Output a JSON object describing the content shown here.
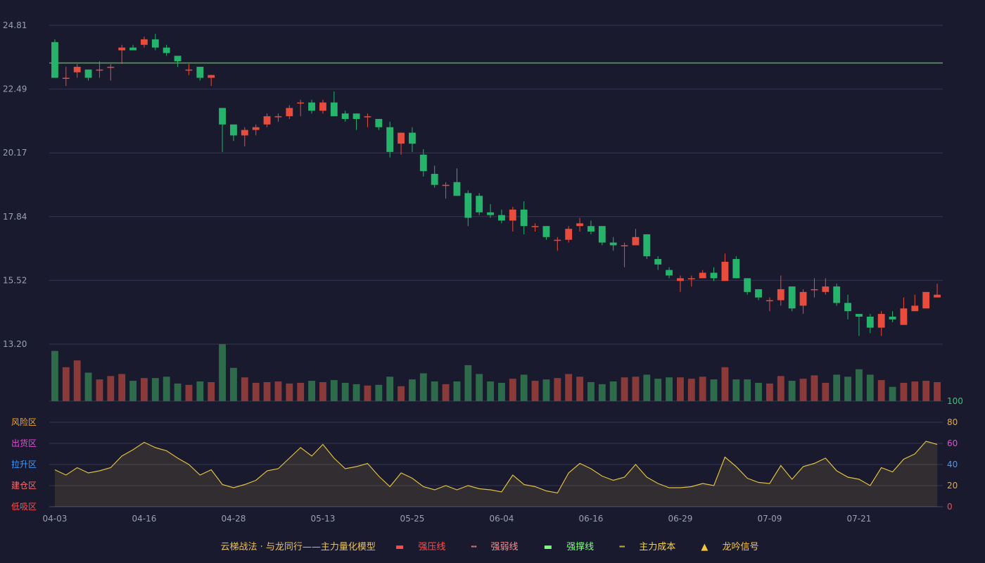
{
  "chart_data": {
    "type": "candlestick",
    "price_axis": {
      "ticks": [
        "24.81",
        "22.49",
        "20.17",
        "17.84",
        "15.52",
        "13.20"
      ],
      "ylim": [
        13.2,
        24.81
      ]
    },
    "reference_line": {
      "value": 23.44,
      "color": "#4caf50"
    },
    "x_labels": [
      "04-03",
      "04-16",
      "04-28",
      "05-13",
      "05-25",
      "06-04",
      "06-16",
      "06-29",
      "07-09",
      "07-21"
    ],
    "x_label_index": [
      0,
      8,
      16,
      24,
      32,
      40,
      48,
      56,
      64,
      72
    ],
    "candles": [
      [
        24.2,
        22.9,
        24.3,
        22.9
      ],
      [
        22.9,
        22.9,
        23.3,
        22.6
      ],
      [
        23.1,
        23.3,
        23.4,
        22.9
      ],
      [
        23.2,
        22.9,
        23.2,
        22.8
      ],
      [
        23.2,
        23.2,
        23.5,
        22.9
      ],
      [
        23.3,
        23.3,
        23.4,
        22.8
      ],
      [
        23.9,
        24.0,
        24.1,
        23.4
      ],
      [
        24.0,
        23.9,
        24.1,
        23.9
      ],
      [
        24.1,
        24.3,
        24.4,
        24.0
      ],
      [
        24.3,
        24.0,
        24.5,
        23.9
      ],
      [
        24.0,
        23.8,
        24.1,
        23.7
      ],
      [
        23.7,
        23.5,
        23.7,
        23.3
      ],
      [
        23.2,
        23.2,
        23.4,
        23.0
      ],
      [
        23.3,
        22.9,
        23.3,
        22.8
      ],
      [
        22.9,
        23.0,
        23.0,
        22.6
      ],
      [
        21.8,
        21.2,
        21.8,
        20.2
      ],
      [
        21.2,
        20.8,
        21.2,
        20.6
      ],
      [
        20.8,
        21.0,
        21.1,
        20.4
      ],
      [
        21.0,
        21.1,
        21.2,
        20.8
      ],
      [
        21.2,
        21.5,
        21.6,
        21.1
      ],
      [
        21.5,
        21.5,
        21.6,
        21.3
      ],
      [
        21.5,
        21.8,
        21.9,
        21.4
      ],
      [
        22.0,
        22.0,
        22.1,
        21.5
      ],
      [
        22.0,
        21.7,
        22.1,
        21.6
      ],
      [
        21.7,
        22.0,
        22.1,
        21.6
      ],
      [
        22.0,
        21.5,
        22.4,
        21.5
      ],
      [
        21.6,
        21.4,
        21.7,
        21.3
      ],
      [
        21.6,
        21.4,
        21.6,
        21.0
      ],
      [
        21.5,
        21.5,
        21.6,
        21.1
      ],
      [
        21.4,
        21.1,
        21.4,
        21.0
      ],
      [
        21.1,
        20.2,
        21.3,
        20.0
      ],
      [
        20.5,
        20.9,
        20.9,
        20.1
      ],
      [
        20.9,
        20.5,
        21.1,
        20.2
      ],
      [
        20.1,
        19.5,
        20.3,
        19.3
      ],
      [
        19.4,
        19.0,
        19.7,
        18.9
      ],
      [
        19.0,
        19.0,
        19.1,
        18.5
      ],
      [
        19.1,
        18.6,
        19.6,
        18.6
      ],
      [
        18.7,
        17.8,
        18.8,
        17.5
      ],
      [
        18.6,
        18.0,
        18.7,
        17.9
      ],
      [
        18.0,
        17.9,
        18.3,
        17.8
      ],
      [
        17.9,
        17.7,
        18.1,
        17.6
      ],
      [
        17.7,
        18.1,
        18.2,
        17.3
      ],
      [
        18.1,
        17.5,
        18.4,
        17.2
      ],
      [
        17.5,
        17.5,
        17.6,
        17.3
      ],
      [
        17.5,
        17.1,
        17.5,
        17.0
      ],
      [
        17.0,
        17.0,
        17.1,
        16.6
      ],
      [
        17.0,
        17.4,
        17.5,
        16.9
      ],
      [
        17.5,
        17.6,
        17.8,
        17.3
      ],
      [
        17.5,
        17.3,
        17.7,
        17.2
      ],
      [
        17.5,
        16.9,
        17.5,
        16.8
      ],
      [
        16.9,
        16.8,
        17.1,
        16.6
      ],
      [
        16.8,
        16.8,
        16.9,
        16.0
      ],
      [
        16.8,
        17.1,
        17.4,
        16.8
      ],
      [
        17.2,
        16.4,
        17.2,
        16.3
      ],
      [
        16.3,
        16.1,
        16.4,
        15.9
      ],
      [
        15.9,
        15.7,
        16.0,
        15.6
      ],
      [
        15.5,
        15.6,
        15.7,
        15.1
      ],
      [
        15.6,
        15.6,
        15.7,
        15.3
      ],
      [
        15.6,
        15.8,
        15.9,
        15.6
      ],
      [
        15.8,
        15.6,
        16.0,
        15.5
      ],
      [
        15.5,
        16.2,
        16.5,
        15.5
      ],
      [
        16.3,
        15.6,
        16.4,
        15.6
      ],
      [
        15.6,
        15.1,
        15.6,
        15.0
      ],
      [
        15.2,
        14.9,
        15.2,
        14.8
      ],
      [
        14.8,
        14.8,
        14.9,
        14.4
      ],
      [
        14.8,
        15.2,
        15.7,
        14.6
      ],
      [
        15.3,
        14.5,
        15.3,
        14.4
      ],
      [
        14.6,
        15.1,
        15.2,
        14.3
      ],
      [
        15.2,
        15.2,
        15.6,
        14.9
      ],
      [
        15.1,
        15.3,
        15.6,
        15.0
      ],
      [
        15.3,
        14.7,
        15.4,
        14.6
      ],
      [
        14.7,
        14.4,
        15.0,
        14.1
      ],
      [
        14.3,
        14.2,
        14.3,
        13.5
      ],
      [
        14.2,
        13.8,
        14.3,
        13.6
      ],
      [
        13.8,
        14.3,
        14.4,
        13.5
      ],
      [
        14.2,
        14.1,
        14.4,
        14.0
      ],
      [
        13.9,
        14.5,
        14.9,
        13.9
      ],
      [
        14.4,
        14.6,
        15.0,
        14.4
      ],
      [
        14.5,
        15.1,
        15.1,
        14.5
      ],
      [
        14.9,
        15.0,
        15.4,
        14.9
      ]
    ],
    "volume": [
      74,
      50,
      60,
      42,
      32,
      37,
      40,
      30,
      34,
      34,
      36,
      26,
      24,
      29,
      28,
      84,
      49,
      35,
      27,
      28,
      29,
      26,
      27,
      30,
      28,
      31,
      27,
      25,
      23,
      24,
      36,
      22,
      32,
      41,
      29,
      25,
      29,
      53,
      40,
      29,
      27,
      33,
      39,
      30,
      32,
      34,
      40,
      36,
      28,
      25,
      29,
      35,
      36,
      39,
      33,
      35,
      35,
      33,
      36,
      32,
      50,
      32,
      32,
      27,
      26,
      37,
      30,
      33,
      38,
      27,
      39,
      36,
      47,
      39,
      31,
      21,
      27,
      29,
      30,
      28
    ],
    "volume_color_up": "#8b3a3a",
    "volume_color_down": "#2e6b4a",
    "color_up": "#e74c3c",
    "color_down": "#26b36b",
    "oscillator": {
      "ylim": [
        0,
        100
      ],
      "ticks": [
        {
          "value": 100,
          "label": "100",
          "color": "#2ecc71"
        },
        {
          "value": 80,
          "label": "80",
          "color": "#f5a623"
        },
        {
          "value": 60,
          "label": "60",
          "color": "#e84ad8"
        },
        {
          "value": 40,
          "label": "40",
          "color": "#3b9cff"
        },
        {
          "value": 20,
          "label": "20",
          "color": "#f5a623"
        },
        {
          "value": 0,
          "label": "0",
          "color": "#ff4d4d"
        }
      ],
      "zones": [
        {
          "value": 80,
          "label": "风险区",
          "color": "#f5a623"
        },
        {
          "value": 60,
          "label": "出货区",
          "color": "#e84ad8"
        },
        {
          "value": 40,
          "label": "拉升区",
          "color": "#3b9cff"
        },
        {
          "value": 20,
          "label": "建仓区",
          "color": "#ff6b6b"
        },
        {
          "value": 0,
          "label": "低吸区",
          "color": "#ff4d4d"
        }
      ],
      "values": [
        35,
        30,
        37,
        32,
        34,
        37,
        48,
        54,
        61,
        56,
        53,
        46,
        40,
        30,
        35,
        21,
        18,
        21,
        25,
        34,
        36,
        46,
        56,
        48,
        59,
        46,
        36,
        38,
        41,
        29,
        19,
        32,
        27,
        19,
        16,
        20,
        16,
        20,
        17,
        16,
        14,
        30,
        21,
        19,
        15,
        13,
        32,
        41,
        36,
        29,
        25,
        28,
        40,
        28,
        22,
        18,
        18,
        19,
        22,
        20,
        47,
        38,
        27,
        23,
        22,
        39,
        26,
        38,
        41,
        46,
        34,
        28,
        26,
        20,
        37,
        33,
        45,
        50,
        62,
        59
      ],
      "color": "#e0c040"
    },
    "legend": [
      {
        "text": "云梯战法 · 与龙同行——主力量化模型",
        "color": "#e8c060"
      },
      {
        "text": "强压线",
        "color": "#ff4d4d",
        "marker": "line"
      },
      {
        "text": "强弱线",
        "color": "#ff8a8a",
        "marker": "dash"
      },
      {
        "text": "强撑线",
        "color": "#7dff7d",
        "marker": "line"
      },
      {
        "text": "主力成本",
        "color": "#f5d142",
        "marker": "dash"
      },
      {
        "text": "龙吟信号",
        "color": "#f5c542",
        "marker": "triangle"
      }
    ]
  }
}
